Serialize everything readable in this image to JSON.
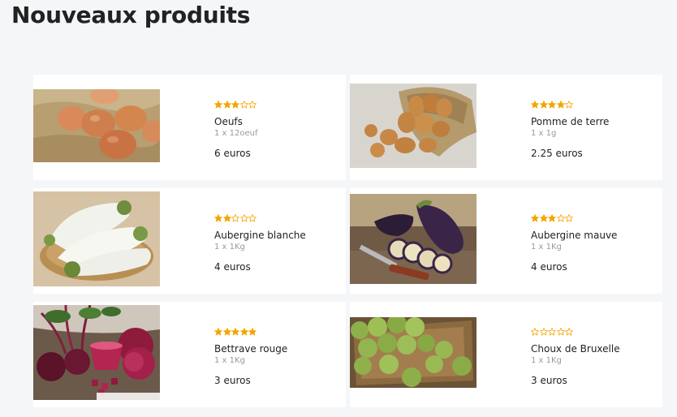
{
  "page": {
    "title": "Nouveaux produits"
  },
  "colors": {
    "star_filled": "#f5a400",
    "star_empty": "#f5a400",
    "card_bg": "#ffffff",
    "page_bg": "#f5f6f8"
  },
  "products": [
    {
      "name": "Oeufs",
      "quantity": "1 x 12oeuf",
      "price": "6 euros",
      "rating": 3,
      "max_rating": 5,
      "image": "eggs-photo"
    },
    {
      "name": "Pomme de terre",
      "quantity": "1 x 1g",
      "price": "2.25 euros",
      "rating": 4,
      "max_rating": 5,
      "image": "potatoes-photo"
    },
    {
      "name": "Aubergine blanche",
      "quantity": "1 x 1Kg",
      "price": "4 euros",
      "rating": 2,
      "max_rating": 5,
      "image": "white-eggplant-photo"
    },
    {
      "name": "Aubergine mauve",
      "quantity": "1 x 1Kg",
      "price": "4 euros",
      "rating": 3,
      "max_rating": 5,
      "image": "purple-eggplant-photo"
    },
    {
      "name": "Bettrave rouge",
      "quantity": "1 x 1Kg",
      "price": "3 euros",
      "rating": 5,
      "max_rating": 5,
      "image": "beetroot-photo"
    },
    {
      "name": "Choux de Bruxelle",
      "quantity": "1 x 1Kg",
      "price": "3 euros",
      "rating": 0,
      "max_rating": 5,
      "image": "brussels-sprouts-photo"
    }
  ]
}
